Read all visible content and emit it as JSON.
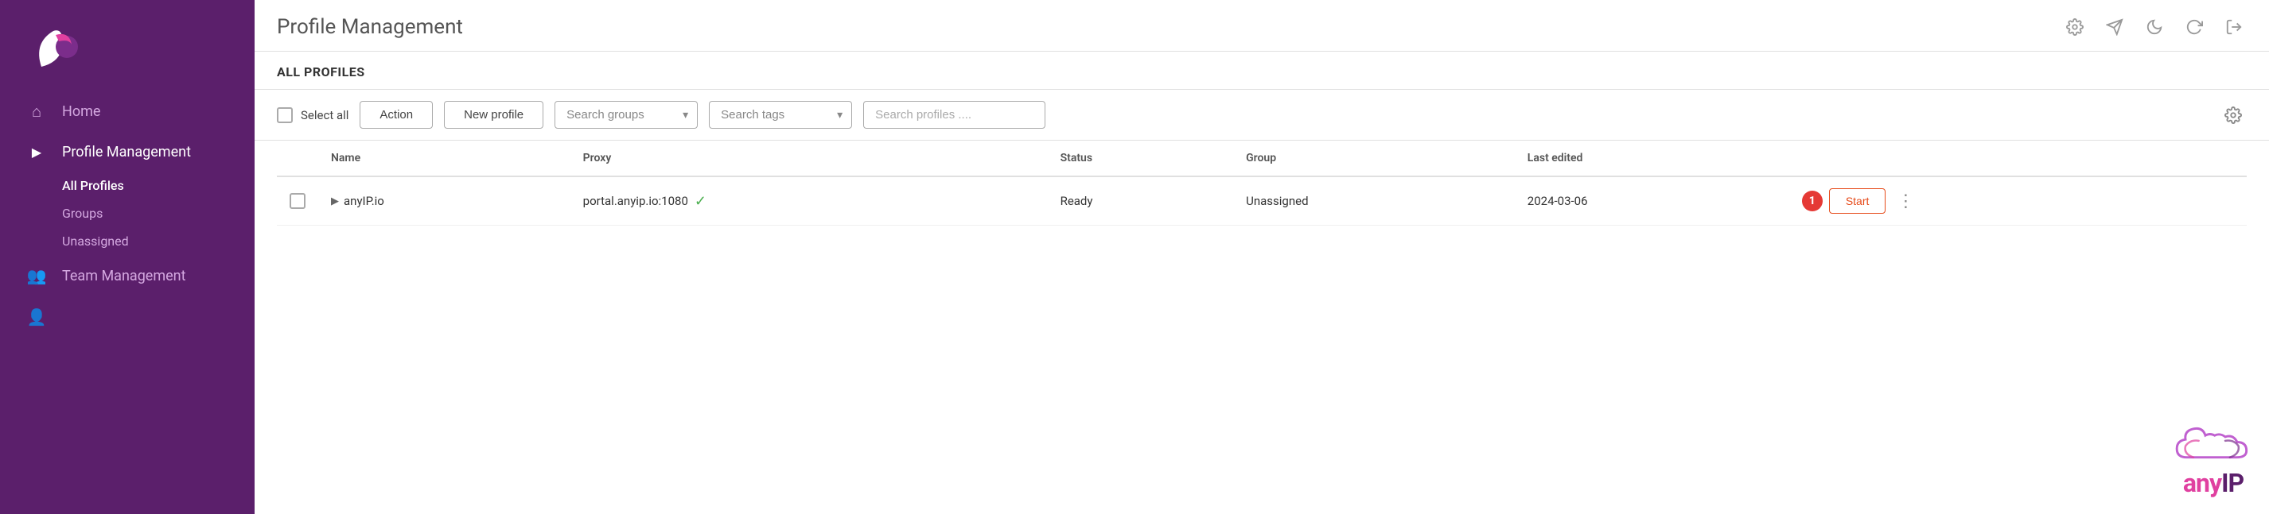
{
  "sidebar": {
    "nav_items": [
      {
        "id": "home",
        "label": "Home",
        "icon": "⌂",
        "active": false
      },
      {
        "id": "profile-management",
        "label": "Profile Management",
        "icon": "▶",
        "active": true
      }
    ],
    "sub_items": [
      {
        "id": "all-profiles",
        "label": "All Profiles",
        "active": true
      },
      {
        "id": "groups",
        "label": "Groups",
        "active": false
      },
      {
        "id": "unassigned",
        "label": "Unassigned",
        "active": false
      }
    ],
    "bottom_items": [
      {
        "id": "team-management",
        "label": "Team Management",
        "icon": "👥",
        "active": false
      },
      {
        "id": "more",
        "label": "...",
        "icon": "👤",
        "active": false
      }
    ]
  },
  "topbar": {
    "title": "Profile Management",
    "icons": [
      "settings-cog",
      "send",
      "moon",
      "refresh",
      "sign-out"
    ]
  },
  "section": {
    "title": "ALL PROFILES"
  },
  "toolbar": {
    "select_all_label": "Select all",
    "action_button_label": "Action",
    "new_profile_button_label": "New profile",
    "search_groups_placeholder": "Search groups",
    "search_tags_placeholder": "Search tags",
    "search_profiles_placeholder": "Search profiles ...."
  },
  "table": {
    "columns": [
      "",
      "Name",
      "Proxy",
      "Status",
      "Group",
      "Last edited",
      ""
    ],
    "rows": [
      {
        "id": "anyip-io",
        "name": "anyIP.io",
        "proxy": "portal.anyip.io:1080",
        "proxy_connected": true,
        "status": "Ready",
        "group": "Unassigned",
        "last_edited": "2024-03-06",
        "start_label": "Start"
      }
    ]
  },
  "badge": {
    "count": "1"
  },
  "anyip_logo": {
    "text": "anyIP"
  }
}
